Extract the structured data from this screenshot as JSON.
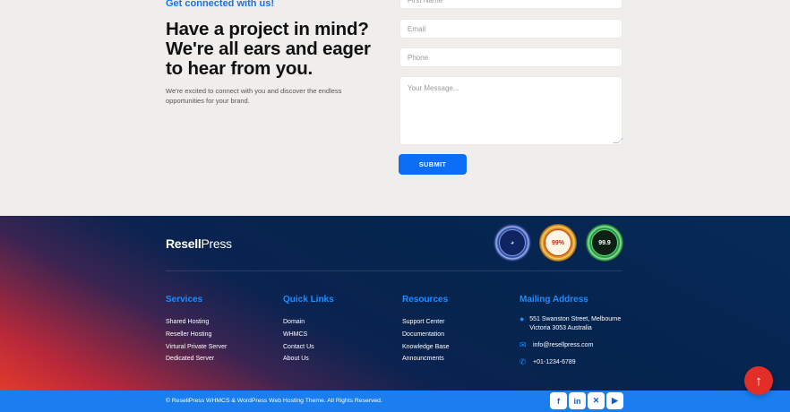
{
  "contact": {
    "eyebrow": "Get connected with us!",
    "headline": "Have a project in mind? We're all ears and eager to hear from you.",
    "lede": "We're excited to connect with you and discover the endless opportunities for your brand.",
    "fields": {
      "first_name_placeholder": "First Name",
      "email_placeholder": "Email",
      "phone_placeholder": "Phone",
      "message_placeholder": "Your Message..."
    },
    "submit_label": "SUBMIT"
  },
  "footer": {
    "logo_strong": "Resell",
    "logo_light": "Press",
    "badges": [
      {
        "text": "◕",
        "icon": "uptime-badge-blue"
      },
      {
        "text": "99%",
        "icon": "uptime-badge-gold"
      },
      {
        "text": "99.9",
        "icon": "uptime-badge-green"
      }
    ],
    "columns": [
      {
        "title": "Services",
        "items": [
          "Shared Hosting",
          "Reseller Hosting",
          "Virtural Private Server",
          "Dedicated Server"
        ]
      },
      {
        "title": "Quick Links",
        "items": [
          "Domain",
          "WHMCS",
          "Contact Us",
          "About Us"
        ]
      },
      {
        "title": "Resources",
        "items": [
          "Support Center",
          "Documentation",
          "Knowledge Base",
          "Announcments"
        ]
      }
    ],
    "mailing": {
      "title": "Mailing Address",
      "address": "551 Swanston Street, Melbourne Victoria 3053 Australia",
      "email": "info@resellpress.com",
      "phone": "+01-1234-6789"
    },
    "copyright": "© ResellPress WHMCS & WordPress Web Hosting Theme. All Rights Reserved.",
    "social": [
      {
        "glyph": "f",
        "icon": "facebook-icon"
      },
      {
        "glyph": "in",
        "icon": "linkedin-icon"
      },
      {
        "glyph": "✕",
        "icon": "x-icon"
      },
      {
        "glyph": "▶",
        "icon": "youtube-icon"
      }
    ]
  },
  "back_to_top": "↑",
  "colors": {
    "accent": "#1a7df0",
    "footer_bg": "#05244e",
    "danger": "#e32d27"
  }
}
